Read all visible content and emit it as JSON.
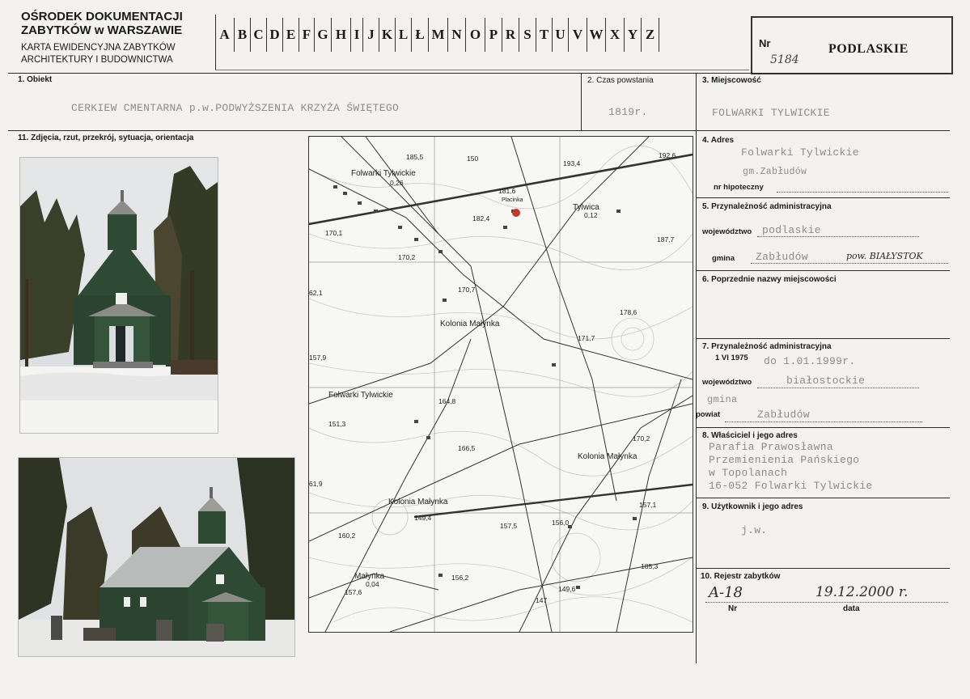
{
  "header": {
    "institution_line1": "OŚRODEK DOKUMENTACJI",
    "institution_line2": "ZABYTKÓW w WARSZAWIE",
    "subtitle_line1": "KARTA EWIDENCYJNA ZABYTKÓW",
    "subtitle_line2": "ARCHITEKTURY I BUDOWNICTWA",
    "letters": [
      "A",
      "B",
      "C",
      "D",
      "E",
      "F",
      "G",
      "H",
      "I",
      "J",
      "K",
      "L",
      "Ł",
      "M",
      "N",
      "O",
      "P",
      "R",
      "S",
      "T",
      "U",
      "V",
      "W",
      "X",
      "Y",
      "Z"
    ],
    "nr_label": "Nr",
    "nr_value": "5184",
    "region": "PODLASKIE"
  },
  "fields": {
    "obiekt_label": "1. Obiekt",
    "obiekt_value": "CERKIEW CMENTARNA p.w.PODWYŻSZENIA KRZYŻA ŚWIĘTEGO",
    "czas_label": "2. Czas powstania",
    "czas_value": "1819r.",
    "miejscowosc_label": "3. Miejscowość",
    "miejscowosc_value": "FOLWARKI TYLWICKIE",
    "zdjecia_label": "11. Zdjęcia, rzut, przekrój, sytuacja, orientacja",
    "adres_label": "4. Adres",
    "adres_line1": "Folwarki Tylwickie",
    "adres_line2": "gm.Zabłudów",
    "hipoteczny_label": "nr hipoteczny",
    "przyn_label": "5. Przynależność administracyjna",
    "woj_label": "województwo",
    "woj_value": "podlaskie",
    "gmina_label": "gmina",
    "gmina_value": "Zabłudów",
    "gmina_hand": "pow. BIAŁYSTOK",
    "poprzednie_label": "6. Poprzednie nazwy miejscowości",
    "przyn1975_label": "7. Przynależność administracyjna",
    "date1975_label": "1 VI 1975",
    "date1975_value": "do 1.01.1999r.",
    "woj2_label": "województwo",
    "woj2_value": "białostockie",
    "gmina2_value": "gmina",
    "powiat_label": "powiat",
    "powiat_value": "Zabłudów",
    "wlasciciel_label": "8. Właściciel i jego adres",
    "wlasciciel_lines": [
      "Parafia Prawosławna",
      "Przemienienia Pańskiego",
      "w Topolanach",
      "16-052 Folwarki Tylwickie"
    ],
    "uzytkownik_label": "9. Użytkownik i jego adres",
    "uzytkownik_value": "j.w.",
    "rejestr_label": "10. Rejestr zabytków",
    "rejestr_nr": "A-18",
    "rejestr_data": "19.12.2000 r.",
    "nr_small": "Nr",
    "data_small": "data"
  },
  "map": {
    "labels": [
      "185,5",
      "150",
      "193,4",
      "192,6",
      "Folwarki Tylwickie",
      "0,26",
      "Tylwica",
      "0,12",
      "Placinka",
      "181,6",
      "182,4",
      "170,1",
      "187,7",
      "170,2",
      "62,1",
      "170,7",
      "178,6",
      "Kolonia Małynka",
      "171,7",
      "157,9",
      "Folwarki Tylwickie",
      "164,8",
      "151,3",
      "166,5",
      "170,2",
      "Kolonia Małynka",
      "61,9",
      "Kolonia Małynka",
      "157,1",
      "149,4",
      "157,5",
      "156,0",
      "160,2",
      "185,3",
      "Małynka",
      "0,04",
      "157,6",
      "156,2",
      "149,6",
      "147"
    ]
  }
}
